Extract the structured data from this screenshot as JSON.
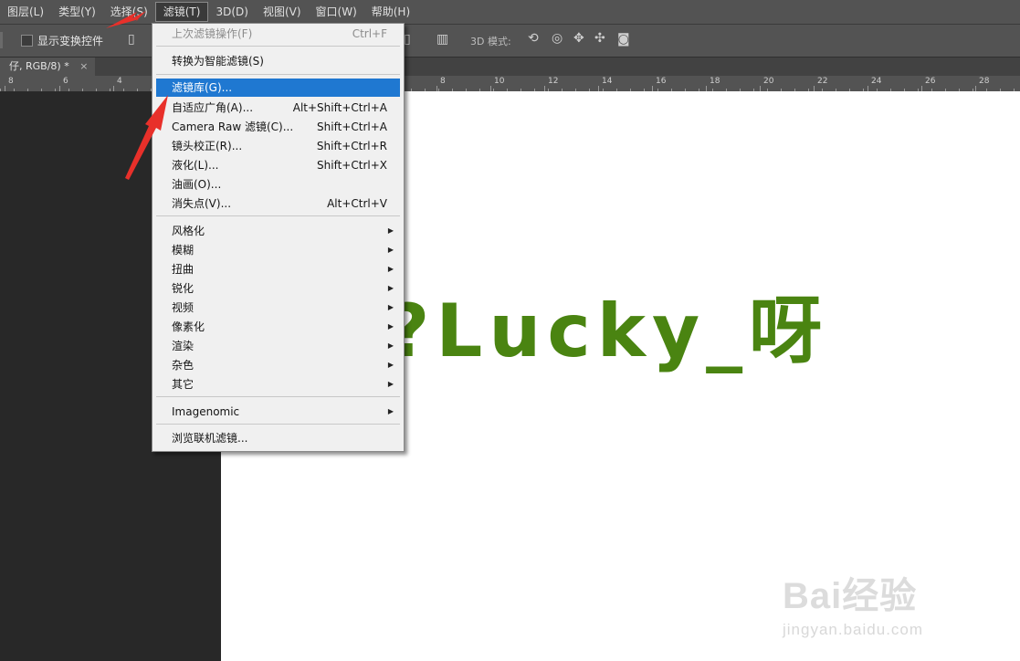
{
  "menubar": {
    "items": [
      {
        "label": "图层(L)"
      },
      {
        "label": "类型(Y)"
      },
      {
        "label": "选择(S)"
      },
      {
        "label": "滤镜(T)",
        "active": true
      },
      {
        "label": "3D(D)"
      },
      {
        "label": "视图(V)"
      },
      {
        "label": "窗口(W)"
      },
      {
        "label": "帮助(H)"
      }
    ]
  },
  "options": {
    "show_transform_controls": "显示变换控件",
    "mode_3d": "3D 模式:"
  },
  "document": {
    "tab_label": "仔, RGB/8) *",
    "close": "×"
  },
  "ruler": {
    "ticks": [
      "8",
      "6",
      "4",
      "8",
      "10",
      "12",
      "14",
      "16",
      "18",
      "20",
      "22",
      "24",
      "26",
      "28"
    ]
  },
  "canvas": {
    "text": "?Lucky_呀",
    "text_color": "#4a8411"
  },
  "filter_menu": {
    "last_filter": {
      "label": "上次滤镜操作(F)",
      "shortcut": "Ctrl+F",
      "disabled": true
    },
    "convert_smart": {
      "label": "转换为智能滤镜(S)"
    },
    "gallery": {
      "label": "滤镜库(G)...",
      "highlighted": true
    },
    "adaptive_wide": {
      "label": "自适应广角(A)...",
      "shortcut": "Alt+Shift+Ctrl+A"
    },
    "camera_raw": {
      "label": "Camera Raw 滤镜(C)...",
      "shortcut": "Shift+Ctrl+A"
    },
    "lens_correction": {
      "label": "镜头校正(R)...",
      "shortcut": "Shift+Ctrl+R"
    },
    "liquify": {
      "label": "液化(L)...",
      "shortcut": "Shift+Ctrl+X"
    },
    "oil_paint": {
      "label": "油画(O)..."
    },
    "vanishing_point": {
      "label": "消失点(V)...",
      "shortcut": "Alt+Ctrl+V"
    },
    "submenus": [
      "风格化",
      "模糊",
      "扭曲",
      "锐化",
      "视频",
      "像素化",
      "渲染",
      "杂色",
      "其它"
    ],
    "imagenomic": {
      "label": "Imagenomic"
    },
    "browse_online": {
      "label": "浏览联机滤镜..."
    }
  },
  "watermark": {
    "main": "Bai经验",
    "sub": "jingyan.baidu.com"
  },
  "colors": {
    "annotation_arrow": "#e8302a",
    "highlight": "#1f78d1"
  }
}
